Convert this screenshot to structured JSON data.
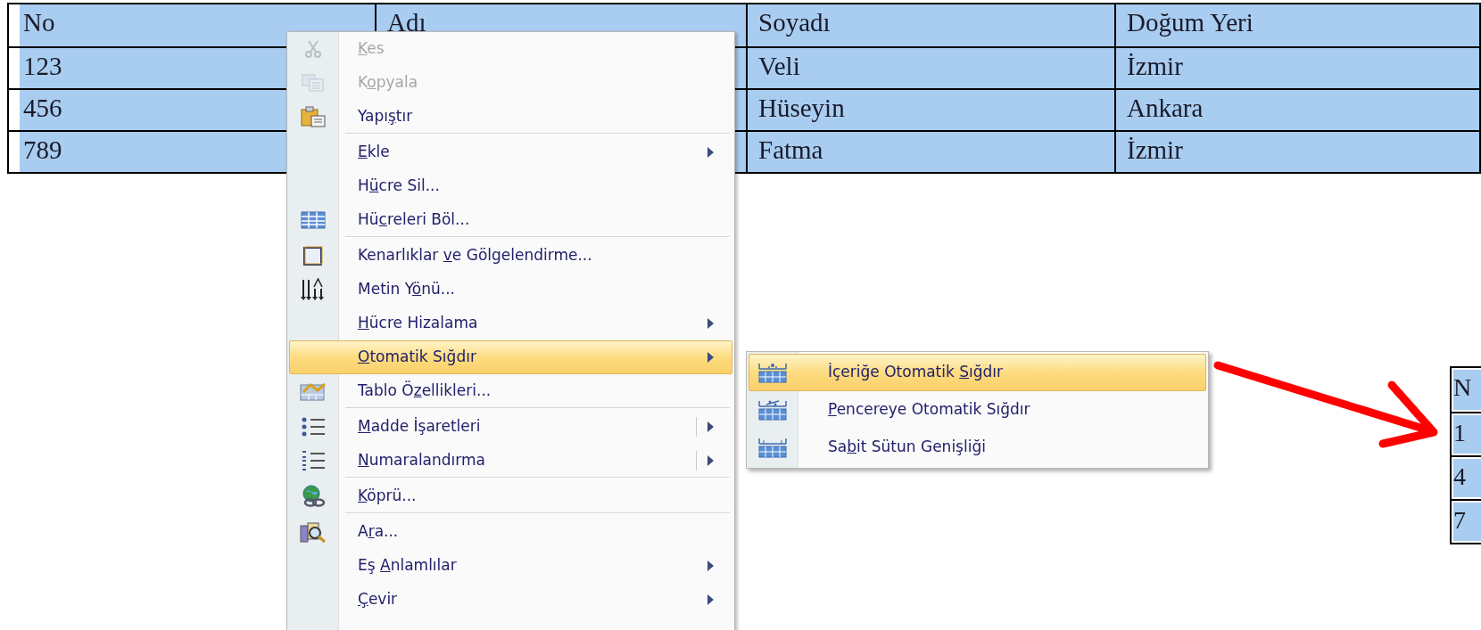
{
  "table": {
    "columns": [
      "No",
      "Adı",
      "Soyadı",
      "Doğum Yeri"
    ],
    "rows": [
      {
        "no": "123",
        "soyadi": "Veli",
        "dogum_yeri": "İzmir"
      },
      {
        "no": "456",
        "soyadi": "Hüseyin",
        "dogum_yeri": "Ankara"
      },
      {
        "no": "789",
        "soyadi": "Fatma",
        "dogum_yeri": "İzmir"
      }
    ]
  },
  "context_menu": {
    "items": [
      {
        "key": "K",
        "post": "es",
        "disabled": true,
        "submenu": false,
        "split": false,
        "selected": false,
        "separator_after": false
      },
      {
        "pre": "K",
        "key": "o",
        "post": "pyala",
        "disabled": true,
        "submenu": false,
        "split": false,
        "selected": false,
        "separator_after": false
      },
      {
        "pre": "Yapı",
        "key": "ş",
        "post": "tır",
        "disabled": false,
        "submenu": false,
        "split": false,
        "selected": false,
        "separator_after": true
      },
      {
        "key": "E",
        "post": "kle",
        "disabled": false,
        "submenu": true,
        "split": false,
        "selected": false,
        "separator_after": false
      },
      {
        "pre": "H",
        "key": "ü",
        "post": "cre Sil...",
        "disabled": false,
        "submenu": false,
        "split": false,
        "selected": false,
        "separator_after": false
      },
      {
        "pre": "Hü",
        "key": "c",
        "post": "releri Böl...",
        "disabled": false,
        "submenu": false,
        "split": false,
        "selected": false,
        "separator_after": true
      },
      {
        "pre": "Kenarlıklar ",
        "key": "v",
        "post": "e Gölgelendirme...",
        "disabled": false,
        "submenu": false,
        "split": false,
        "selected": false,
        "separator_after": false
      },
      {
        "pre": "Metin Y",
        "key": "ö",
        "post": "nü...",
        "disabled": false,
        "submenu": false,
        "split": false,
        "selected": false,
        "separator_after": false
      },
      {
        "key": "H",
        "post": "ücre Hizalama",
        "disabled": false,
        "submenu": true,
        "split": false,
        "selected": false,
        "separator_after": false
      },
      {
        "key": "O",
        "post": "tomatik Sığdır",
        "disabled": false,
        "submenu": true,
        "split": false,
        "selected": true,
        "separator_after": false
      },
      {
        "pre": "Tablo Ö",
        "key": "z",
        "post": "ellikleri...",
        "disabled": false,
        "submenu": false,
        "split": false,
        "selected": false,
        "separator_after": true
      },
      {
        "key": "M",
        "post": "adde İşaretleri",
        "disabled": false,
        "submenu": true,
        "split": true,
        "selected": false,
        "separator_after": false
      },
      {
        "key": "N",
        "post": "umaralandırma",
        "disabled": false,
        "submenu": true,
        "split": true,
        "selected": false,
        "separator_after": true
      },
      {
        "key": "K",
        "post": "öprü...",
        "disabled": false,
        "submenu": false,
        "split": false,
        "selected": false,
        "separator_after": true
      },
      {
        "pre": "A",
        "key": "r",
        "post": "a...",
        "disabled": false,
        "submenu": false,
        "split": false,
        "selected": false,
        "separator_after": false
      },
      {
        "pre": "Eş ",
        "key": "A",
        "post": "nlamlılar",
        "disabled": false,
        "submenu": true,
        "split": false,
        "selected": false,
        "separator_after": false
      },
      {
        "key": "Ç",
        "post": "evir",
        "disabled": false,
        "submenu": true,
        "split": false,
        "selected": false,
        "separator_after": false
      }
    ]
  },
  "submenu": {
    "items": [
      {
        "pre": "İçeriğe Otomatik ",
        "key": "S",
        "post": "ığdır",
        "selected": true
      },
      {
        "key": "P",
        "post": "encereye Otomatik Sığdır",
        "selected": false
      },
      {
        "pre": "Sa",
        "key": "b",
        "post": "it Sütun Genişliği",
        "selected": false
      }
    ]
  },
  "result_table": {
    "rows": [
      "N",
      "1",
      "4",
      "7"
    ]
  }
}
